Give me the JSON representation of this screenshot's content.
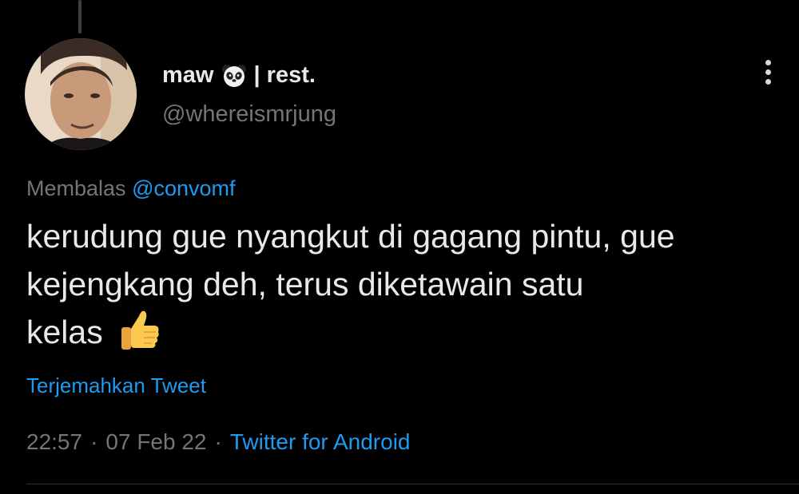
{
  "tweet": {
    "author": {
      "name_start": "maw",
      "name_end": "| rest.",
      "handle": "@whereismrjung",
      "name_emoji_icon": "panda-face-icon"
    },
    "reply": {
      "prefix": "Membalas",
      "mention": "@convomf"
    },
    "text": {
      "line1": "kerudung gue nyangkut di gagang pintu, gue",
      "line2": "kejengkang deh, terus diketawain satu",
      "line3": "kelas",
      "trailing_emoji_icon": "thumbs-up-icon"
    },
    "translate_label": "Terjemahkan Tweet",
    "meta": {
      "time": "22:57",
      "separator": "·",
      "date": "07 Feb 22",
      "source": "Twitter for Android"
    },
    "more_icon": "more-vertical-icon"
  },
  "colors": {
    "background": "#000000",
    "primary_text": "#e7e9ea",
    "secondary_text": "#71767b",
    "accent": "#1d9bf0",
    "divider": "#2f3336"
  }
}
